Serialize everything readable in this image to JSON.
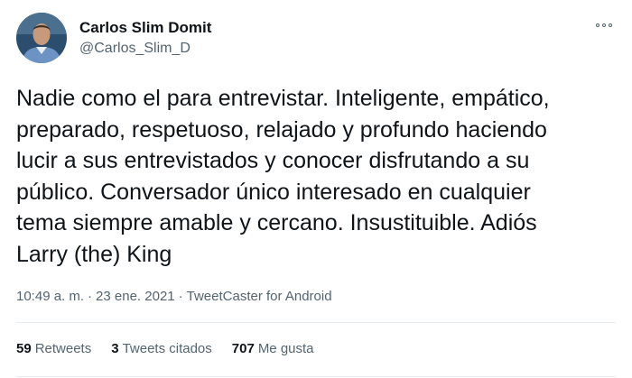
{
  "author": {
    "display_name": "Carlos Slim Domit",
    "handle": "@Carlos_Slim_D"
  },
  "tweet": {
    "text": "Nadie como el para entrevistar. Inteligente, empático,\npreparado, respetuoso, relajado y profundo haciendo\nlucir a sus entrevistados y conocer disfrutando a su\npúblico. Conversador único interesado en cualquier\ntema siempre amable y cercano. Insustituible. Adiós\nLarry (the) King"
  },
  "meta": {
    "time": "10:49 a. m.",
    "separator_1": "·",
    "date": "23 ene. 2021",
    "separator_2": "·",
    "source": "TweetCaster for Android"
  },
  "stats": {
    "retweets_count": "59",
    "retweets_label": "Retweets",
    "quotes_count": "3",
    "quotes_label": "Tweets citados",
    "likes_count": "707",
    "likes_label": "Me gusta"
  },
  "icons": {
    "more": "more-options-icon"
  },
  "colors": {
    "text_primary": "#0f1419",
    "text_secondary": "#536471",
    "divider": "#e6ecf0"
  }
}
